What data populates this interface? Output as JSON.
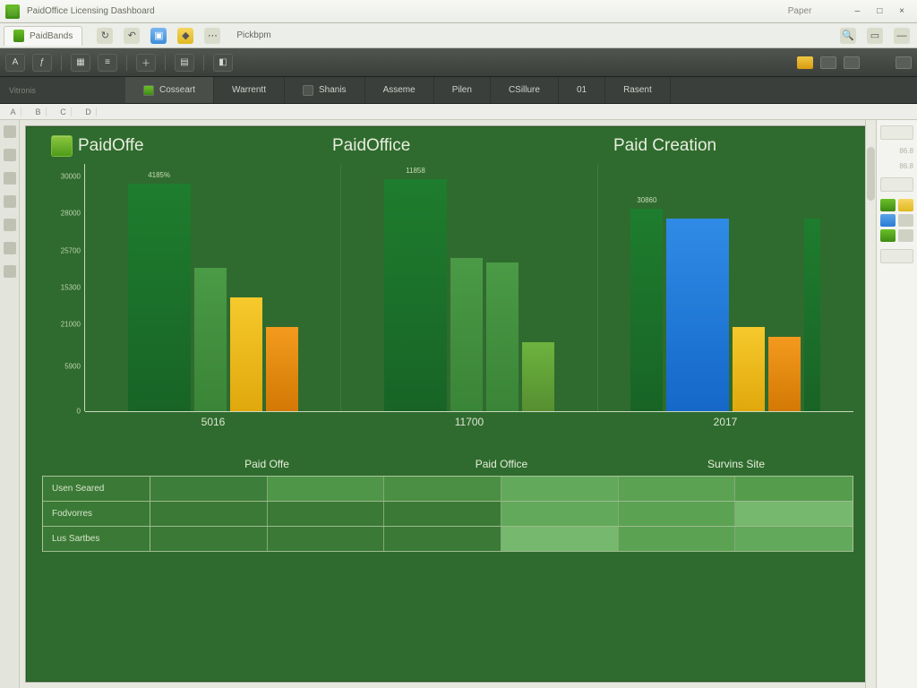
{
  "titlebar": {
    "app_name": "PaidOffice Licensing Dashboard",
    "extra": "Paper"
  },
  "window_controls": {
    "min": "–",
    "max": "□",
    "close": "×"
  },
  "filetab": {
    "doc_name": "PaidBands",
    "popup_label": "Pickbpm"
  },
  "ribbon_tabs": {
    "side_label": "Vitronis",
    "items": [
      {
        "label": "Cosseart"
      },
      {
        "label": "Warrentt"
      },
      {
        "label": "Shanis"
      },
      {
        "label": "Asseme"
      },
      {
        "label": "Pilen"
      },
      {
        "label": "CSillure"
      },
      {
        "label": "01"
      },
      {
        "label": "Rasent"
      }
    ]
  },
  "ruler": [
    "A",
    "B",
    "C",
    "D"
  ],
  "canvas": {
    "headers": [
      "PaidOffe",
      "PaidOffice",
      "Paid Creation"
    ]
  },
  "chart_data": {
    "type": "bar",
    "ylabel": "",
    "xlabel": "",
    "ylim": [
      0,
      30000
    ],
    "y_ticks": [
      "30000",
      "28000",
      "25700",
      "15300",
      "21000",
      "5900",
      "0"
    ],
    "categories": [
      "5016",
      "11700",
      "2017"
    ],
    "series_labels": {
      "dkg": {
        "0": "4185%",
        "1": "11858",
        "2": "30860"
      }
    },
    "groups": [
      {
        "bars": [
          {
            "color": "c-dkg",
            "h": 92,
            "big": true,
            "val_key": "dkg.0"
          },
          {
            "color": "c-mg",
            "h": 58
          },
          {
            "color": "c-yl",
            "h": 46
          },
          {
            "color": "c-or",
            "h": 34
          }
        ]
      },
      {
        "bars": [
          {
            "color": "c-dkg",
            "h": 94,
            "big": true,
            "val_key": "dkg.1"
          },
          {
            "color": "c-mg",
            "h": 62
          },
          {
            "color": "c-mg",
            "h": 60
          },
          {
            "color": "c-lg",
            "h": 28
          }
        ]
      },
      {
        "bars": [
          {
            "color": "c-dkg",
            "h": 82,
            "big": false,
            "val_key": "dkg.2"
          },
          {
            "color": "c-bl",
            "h": 78,
            "big": true
          },
          {
            "color": "c-yl",
            "h": 34
          },
          {
            "color": "c-or",
            "h": 30
          },
          {
            "color": "c-dkg",
            "h": 78,
            "thin": true
          }
        ]
      }
    ]
  },
  "table": {
    "col_headers": [
      "Paid Offe",
      "Paid Office",
      "Survins Site"
    ],
    "rows": [
      {
        "label": "Usen Seared",
        "cells": [
          "#3d7f3a",
          "#4f9648",
          "#4a8f44",
          "#63a95b",
          "#5ba253",
          "#559c4d"
        ]
      },
      {
        "label": "Fodvorres",
        "cells": [
          "#3a7a36",
          "#3a7a36",
          "#3a7a36",
          "#63a95b",
          "#5ba253",
          "#76b86d"
        ]
      },
      {
        "label": "Lus Sartbes",
        "cells": [
          "#3a7a36",
          "#3a7a36",
          "#3a7a36",
          "#76b86d",
          "#5ba253",
          "#63a95b"
        ]
      }
    ]
  },
  "right_panel": {
    "hint1": "86.8",
    "hint2": "86.8"
  }
}
